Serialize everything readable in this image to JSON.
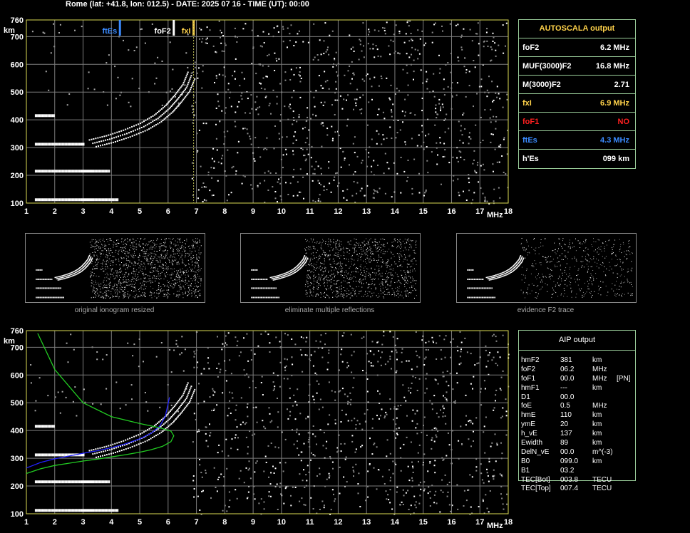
{
  "header": {
    "title": "Rome (lat: +41.8, lon: 012.5) - DATE: 2025 07 16 - TIME (UT): 00:00"
  },
  "autoscala": {
    "title": "AUTOSCALA output",
    "rows": [
      {
        "label": "foF2",
        "value": "6.2 MHz",
        "color": "#ffffff"
      },
      {
        "label": "MUF(3000)F2",
        "value": "16.8 MHz",
        "color": "#ffffff"
      },
      {
        "label": "M(3000)F2",
        "value": "2.71",
        "color": "#ffffff"
      },
      {
        "label": "fxI",
        "value": "6.9 MHz",
        "color": "#ffd24a"
      },
      {
        "label": "foF1",
        "value": "NO",
        "color": "#ff2020"
      },
      {
        "label": "ftEs",
        "value": "4.3 MHz",
        "color": "#3b8bff"
      },
      {
        "label": "h'Es",
        "value": "099    km",
        "color": "#ffffff"
      }
    ]
  },
  "aip": {
    "title": "AIP output",
    "rows": [
      {
        "param": "hmF2",
        "value": "381",
        "unit": "km",
        "extra": ""
      },
      {
        "param": "foF2",
        "value": "06.2",
        "unit": "MHz",
        "extra": ""
      },
      {
        "param": "foF1",
        "value": "00.0",
        "unit": "MHz",
        "extra": "[PN]"
      },
      {
        "param": "hmF1",
        "value": "---",
        "unit": "km",
        "extra": ""
      },
      {
        "param": "D1",
        "value": "00.0",
        "unit": "",
        "extra": ""
      },
      {
        "param": "foE",
        "value": "0.5",
        "unit": "MHz",
        "extra": ""
      },
      {
        "param": "hmE",
        "value": "110",
        "unit": "km",
        "extra": ""
      },
      {
        "param": "ymE",
        "value": "20",
        "unit": "km",
        "extra": ""
      },
      {
        "param": "h_vE",
        "value": "137",
        "unit": "km",
        "extra": ""
      },
      {
        "param": "Ewidth",
        "value": "89",
        "unit": "km",
        "extra": ""
      },
      {
        "param": "DelN_vE",
        "value": "00.0",
        "unit": "m^(-3)",
        "extra": ""
      },
      {
        "param": "B0",
        "value": "099.0",
        "unit": "km",
        "extra": ""
      },
      {
        "param": "B1",
        "value": "03.2",
        "unit": "",
        "extra": ""
      },
      {
        "param": "TEC[Bot]",
        "value": "003.8",
        "unit": "TECU",
        "extra": ""
      },
      {
        "param": "TEC[Top]",
        "value": "007.4",
        "unit": "TECU",
        "extra": ""
      }
    ]
  },
  "thumbnails": [
    {
      "caption": "original ionogram resized"
    },
    {
      "caption": "eliminate multiple reflections"
    },
    {
      "caption": "evidence F2 trace"
    }
  ],
  "chart_data": [
    {
      "type": "scatter",
      "name": "autoscala-ionogram",
      "xlabel": "MHz",
      "ylabel": "km",
      "xlim": [
        1,
        18
      ],
      "ylim": [
        100,
        760
      ],
      "xticks": [
        1,
        2,
        3,
        4,
        5,
        6,
        7,
        8,
        9,
        10,
        11,
        12,
        13,
        14,
        15,
        16,
        17,
        18
      ],
      "yticks": [
        100,
        200,
        300,
        400,
        500,
        600,
        700,
        760
      ],
      "grid": true,
      "markers": [
        {
          "label": "ftEs",
          "x": 4.3,
          "color": "#3b8bff"
        },
        {
          "label": "foF2",
          "x": 6.2,
          "color": "#ffffff"
        },
        {
          "label": "fxI",
          "x": 6.9,
          "color": "#ffd24a"
        }
      ],
      "es_traces": [
        {
          "x": [
            1.3,
            4.2
          ],
          "y": 112
        },
        {
          "x": [
            1.3,
            3.9
          ],
          "y": 215
        },
        {
          "x": [
            1.3,
            3.0
          ],
          "y": 312
        },
        {
          "x": [
            1.3,
            2.0
          ],
          "y": 415
        }
      ],
      "f2_trace": {
        "x": [
          3.2,
          3.8,
          4.4,
          5.0,
          5.5,
          5.9,
          6.2,
          6.5,
          6.7
        ],
        "y": [
          330,
          345,
          365,
          390,
          420,
          455,
          490,
          530,
          580
        ]
      }
    },
    {
      "type": "line",
      "name": "aip-ionogram",
      "xlabel": "MHz",
      "ylabel": "km",
      "xlim": [
        1,
        18
      ],
      "ylim": [
        100,
        760
      ],
      "xticks": [
        1,
        2,
        3,
        4,
        5,
        6,
        7,
        8,
        9,
        10,
        11,
        12,
        13,
        14,
        15,
        16,
        17,
        18
      ],
      "yticks": [
        100,
        200,
        300,
        400,
        500,
        600,
        700,
        760
      ],
      "grid": true,
      "series": [
        {
          "color": "#2222ff",
          "x": [
            1.0,
            1.5,
            2.0,
            2.5,
            3.0,
            3.5,
            4.0,
            4.5,
            5.0,
            5.4,
            5.7,
            5.9,
            6.05
          ],
          "y": [
            265,
            285,
            298,
            308,
            318,
            327,
            338,
            352,
            370,
            390,
            415,
            450,
            520
          ]
        },
        {
          "color": "#22cc22",
          "x": [
            1.0,
            1.5,
            2.0,
            2.5,
            3.0,
            3.5,
            4.0,
            4.5,
            5.0,
            5.4,
            5.8,
            6.1,
            6.2,
            6.1,
            5.7,
            5.0,
            4.0,
            3.0,
            2.0,
            1.4
          ],
          "y": [
            245,
            262,
            274,
            282,
            290,
            297,
            305,
            313,
            322,
            331,
            343,
            360,
            381,
            398,
            410,
            425,
            450,
            500,
            620,
            750
          ]
        }
      ]
    }
  ]
}
